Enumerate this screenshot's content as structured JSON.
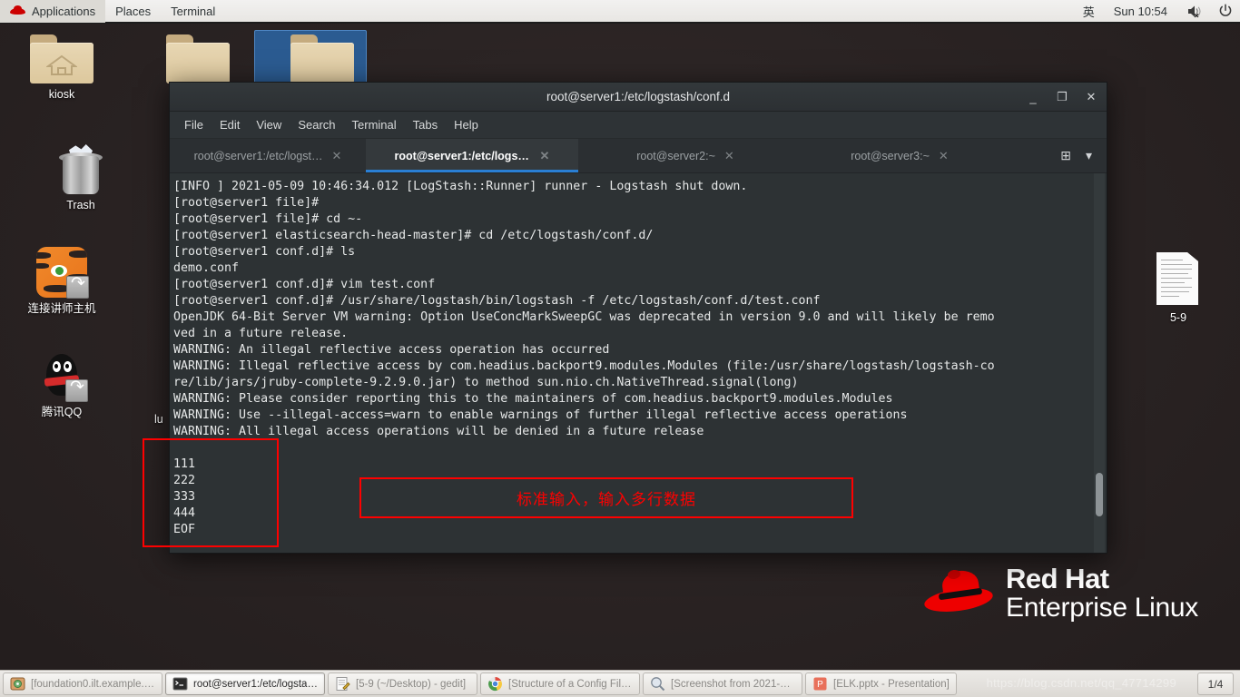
{
  "top_panel": {
    "logo_icon": "redhat-icon",
    "menus": [
      "Applications",
      "Places",
      "Terminal"
    ],
    "ime_indicator": "英",
    "clock": "Sun 10:54",
    "volume_icon": "volume-muted-icon",
    "power_icon": "power-icon"
  },
  "desktop": {
    "icons": [
      {
        "label": "kiosk",
        "icon": "home-folder-icon",
        "selected": false
      },
      {
        "label": "",
        "icon": "folder-icon",
        "selected": false
      },
      {
        "label": "",
        "icon": "folder-icon",
        "selected": true
      },
      {
        "label": "Trash",
        "icon": "trash-icon",
        "selected": false
      },
      {
        "label": "连接讲师主机",
        "icon": "tiger-shortcut-icon",
        "selected": false
      },
      {
        "label": "腾讯QQ",
        "icon": "qq-shortcut-icon",
        "selected": false
      },
      {
        "label": "5-9",
        "icon": "text-document-icon",
        "selected": false
      }
    ],
    "obscured_label": "lu",
    "logo": {
      "line1": "Red Hat",
      "line2": "Enterprise Linux",
      "hat_color": "#ee0000"
    }
  },
  "terminal": {
    "title": "root@server1:/etc/logstash/conf.d",
    "window_buttons": {
      "minimize": "_",
      "maximize": "❐",
      "close": "✕"
    },
    "menus": [
      "File",
      "Edit",
      "View",
      "Search",
      "Terminal",
      "Tabs",
      "Help"
    ],
    "tabs": [
      {
        "label": "root@server1:/etc/logst…",
        "active": false,
        "close": "✕"
      },
      {
        "label": "root@server1:/etc/logst…",
        "active": true,
        "close": "✕"
      },
      {
        "label": "root@server2:~",
        "active": false,
        "close": "✕"
      },
      {
        "label": "root@server3:~",
        "active": false,
        "close": "✕"
      }
    ],
    "tabbar_buttons": [
      {
        "name": "new-tab-icon",
        "glyph": "⊞"
      },
      {
        "name": "tab-list-chevron-icon",
        "glyph": "▾"
      }
    ],
    "output": "[INFO ] 2021-05-09 10:46:34.012 [LogStash::Runner] runner - Logstash shut down.\n[root@server1 file]#\n[root@server1 file]# cd ~-\n[root@server1 elasticsearch-head-master]# cd /etc/logstash/conf.d/\n[root@server1 conf.d]# ls\ndemo.conf\n[root@server1 conf.d]# vim test.conf\n[root@server1 conf.d]# /usr/share/logstash/bin/logstash -f /etc/logstash/conf.d/test.conf\nOpenJDK 64-Bit Server VM warning: Option UseConcMarkSweepGC was deprecated in version 9.0 and will likely be remo\nved in a future release.\nWARNING: An illegal reflective access operation has occurred\nWARNING: Illegal reflective access by com.headius.backport9.modules.Modules (file:/usr/share/logstash/logstash-co\nre/lib/jars/jruby-complete-9.2.9.0.jar) to method sun.nio.ch.NativeThread.signal(long)\nWARNING: Please consider reporting this to the maintainers of com.headius.backport9.modules.Modules\nWARNING: Use --illegal-access=warn to enable warnings of further illegal reflective access operations\nWARNING: All illegal access operations will be denied in a future release\n\n111\n222\n333\n444\nEOF"
  },
  "annotations": {
    "note_text": "标准输入，输入多行数据",
    "color": "#fe0000"
  },
  "taskbar": {
    "buttons": [
      {
        "label": "[foundation0.ilt.example.co…",
        "icon": "vm-viewer-icon",
        "active": false
      },
      {
        "label": "root@server1:/etc/logstash…",
        "icon": "terminal-icon",
        "active": true
      },
      {
        "label": "[5-9 (~/Desktop) - gedit]",
        "icon": "gedit-icon",
        "active": false
      },
      {
        "label": "[Structure of a Config File |…",
        "icon": "chrome-icon",
        "active": false
      },
      {
        "label": "[Screenshot from 2021-05-…",
        "icon": "image-viewer-icon",
        "active": false
      },
      {
        "label": "[ELK.pptx - Presentation]",
        "icon": "impress-icon",
        "active": false
      }
    ],
    "workspace_indicator": "1/4",
    "watermark": "https://blog.csdn.net/qq_47714299"
  }
}
